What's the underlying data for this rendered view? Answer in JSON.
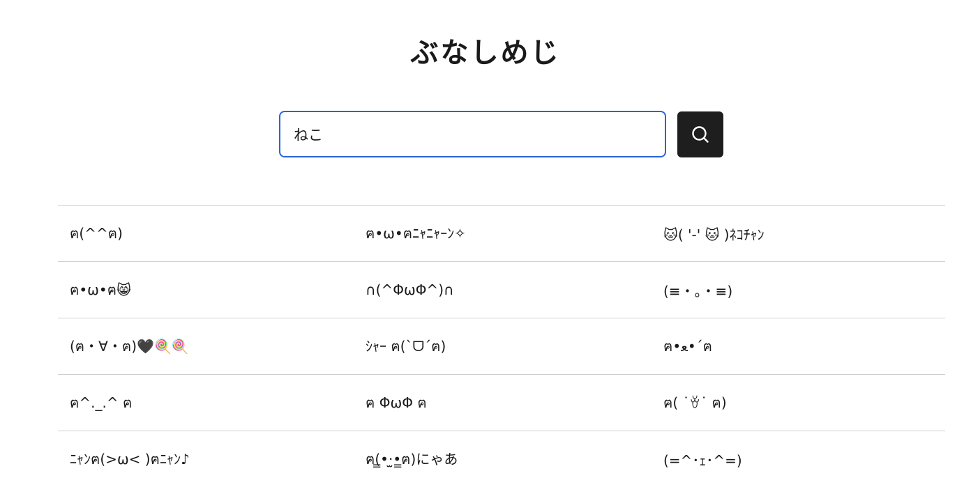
{
  "header": {
    "title": "ぶなしめじ"
  },
  "search": {
    "value": "ねこ",
    "button_icon": "search-icon"
  },
  "results": [
    [
      "ฅ(^^ฅ)",
      "ฅ•ω•ฅﾆｬﾆｬｰﾝ✧",
      "🐱( '-' 🐱 )ﾈｺﾁｬﾝ"
    ],
    [
      "ฅ•ω•ฅ😸",
      "∩(^ΦωΦ^)∩",
      "(≡・。・≡)"
    ],
    [
      "(ฅ・∀・ฅ)🖤🍭🍭",
      "ｼｬｰ ฅ(`ᗜ´ฅ)",
      "ฅ•ﻌ•´ฅ"
    ],
    [
      "ฅ^._.^ ฅ",
      "ฅ ΦωΦ ฅ",
      "ฅ( ˙ꈊ˙ ฅ)"
    ],
    [
      "ﾆｬﾝฅ(>ω< )ฅﾆｬﾝ♪",
      "ฅ(̳•·̫•̳ฅ)にゃあ",
      "(=^･ｪ･^=)"
    ]
  ]
}
